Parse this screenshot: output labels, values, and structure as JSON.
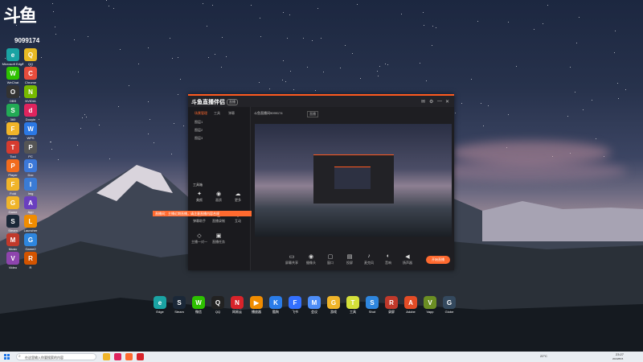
{
  "watermark": {
    "logo": "斗鱼",
    "room_id": "9099174"
  },
  "desktop_left": [
    {
      "label": "Microsoft Edge",
      "color": "#1aa3a3",
      "glyph": "e"
    },
    {
      "label": "QQ",
      "color": "#e8b923",
      "glyph": "Q"
    },
    {
      "label": "WeChat",
      "color": "#2dc100",
      "glyph": "W"
    },
    {
      "label": "Chrome",
      "color": "#e74c3c",
      "glyph": "C"
    },
    {
      "label": "OBS",
      "color": "#333333",
      "glyph": "O"
    },
    {
      "label": "NVIDIA",
      "color": "#76b900",
      "glyph": "N"
    },
    {
      "label": "360",
      "color": "#22aa55",
      "glyph": "S"
    },
    {
      "label": "Douyin",
      "color": "#e0245e",
      "glyph": "d"
    },
    {
      "label": "Folder",
      "color": "#f0b429",
      "glyph": "F"
    },
    {
      "label": "WPS",
      "color": "#2b78e4",
      "glyph": "W"
    },
    {
      "label": "Tool",
      "color": "#d63b2f",
      "glyph": "T"
    },
    {
      "label": "PC",
      "color": "#555555",
      "glyph": "P"
    },
    {
      "label": "Player",
      "color": "#f26b1d",
      "glyph": "P"
    },
    {
      "label": "Doc",
      "color": "#3c78d8",
      "glyph": "D"
    },
    {
      "label": "Fold",
      "color": "#f0b429",
      "glyph": "F"
    },
    {
      "label": "Img",
      "color": "#3a7bd5",
      "glyph": "I"
    },
    {
      "label": "Game",
      "color": "#f0b429",
      "glyph": "G"
    },
    {
      "label": "App",
      "color": "#6a3fbf",
      "glyph": "A"
    },
    {
      "label": "Steam",
      "color": "#1b2838",
      "glyph": "S"
    },
    {
      "label": "Launcher",
      "color": "#f08c00",
      "glyph": "L"
    },
    {
      "label": "Music",
      "color": "#c0392b",
      "glyph": "M"
    },
    {
      "label": "Game2",
      "color": "#2e86de",
      "glyph": "G"
    },
    {
      "label": "Video",
      "color": "#8e44ad",
      "glyph": "V"
    },
    {
      "label": "R",
      "color": "#d35400",
      "glyph": "R"
    }
  ],
  "app": {
    "brand": "斗鱼直播伴侣",
    "version": "直播",
    "sidebar_tabs": [
      "场景管理",
      "工具",
      "弹幕"
    ],
    "scenes": [
      "图层1",
      "图层2",
      "图层3"
    ],
    "tools_header": "工具箱",
    "tools": [
      {
        "label": "美颜",
        "icon": "✦"
      },
      {
        "label": "画质",
        "icon": "◉"
      },
      {
        "label": "更多",
        "icon": "☁"
      },
      {
        "label": "弹幕助手",
        "icon": "⊞"
      },
      {
        "label": "直播录制",
        "icon": "◎"
      },
      {
        "label": "互动",
        "icon": "◈"
      },
      {
        "label": "主播一对一",
        "icon": "◇"
      },
      {
        "label": "直播任务",
        "icon": "▣"
      }
    ],
    "room_title": "斗鱼直播间9099174",
    "room_tag": "直播",
    "controls": [
      {
        "label": "屏幕共享",
        "icon": "▭"
      },
      {
        "label": "摄像头",
        "icon": "◉"
      },
      {
        "label": "窗口",
        "icon": "▢"
      },
      {
        "label": "投屏",
        "icon": "▤"
      },
      {
        "label": "麦克风",
        "icon": "♪"
      },
      {
        "label": "音响",
        "icon": "◐"
      },
      {
        "label": "扬声器",
        "icon": "◀"
      }
    ],
    "start_label": "开始直播",
    "tooltip": "直播间：主播近期直播，请注意直播内容合规"
  },
  "dock": [
    {
      "label": "Edge",
      "color": "#1aa3a3",
      "glyph": "e"
    },
    {
      "label": "Steam",
      "color": "#1b2838",
      "glyph": "S"
    },
    {
      "label": "微信",
      "color": "#2dc100",
      "glyph": "W"
    },
    {
      "label": "QQ",
      "color": "#222222",
      "glyph": "Q"
    },
    {
      "label": "网易云",
      "color": "#d8232a",
      "glyph": "N"
    },
    {
      "label": "播放器",
      "color": "#f08c00",
      "glyph": "▶"
    },
    {
      "label": "酷狗",
      "color": "#2a7ce8",
      "glyph": "K"
    },
    {
      "label": "飞书",
      "color": "#3370ff",
      "glyph": "F"
    },
    {
      "label": "会议",
      "color": "#4d8df7",
      "glyph": "M"
    },
    {
      "label": "游戏",
      "color": "#f0b429",
      "glyph": "G"
    },
    {
      "label": "工具",
      "color": "#d4e03a",
      "glyph": "T"
    },
    {
      "label": "Shot",
      "color": "#2e86de",
      "glyph": "S"
    },
    {
      "label": "录屏",
      "color": "#c0392b",
      "glyph": "R"
    },
    {
      "label": "Adobe",
      "color": "#e34c26",
      "glyph": "A"
    },
    {
      "label": "Vapp",
      "color": "#6b8e23",
      "glyph": "V"
    },
    {
      "label": "Globe",
      "color": "#34495e",
      "glyph": "G"
    }
  ],
  "taskbar": {
    "search_placeholder": "在这里输入你要搜索的内容",
    "weather": "22°C",
    "time": "23:27",
    "date": "2024/8/15"
  },
  "colors": {
    "accent": "#ff6a2f",
    "window_bg": "#1e1e22"
  }
}
